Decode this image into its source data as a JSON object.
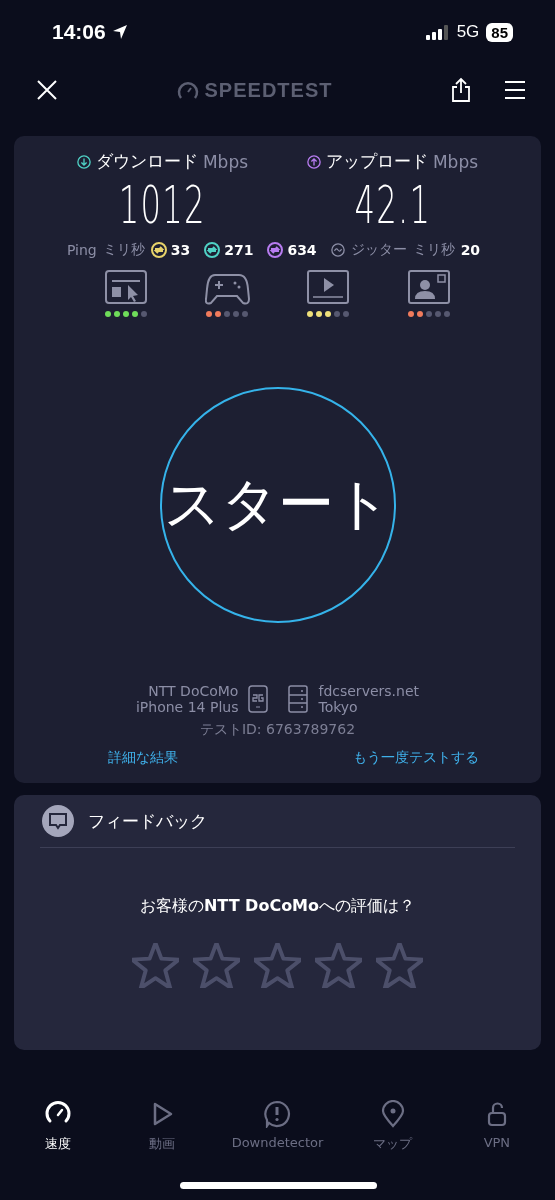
{
  "status_bar": {
    "time": "14:06",
    "network": "5G",
    "battery": "85"
  },
  "header": {
    "logo": "SPEEDTEST"
  },
  "results": {
    "download": {
      "label": "ダウンロード",
      "unit": "Mbps",
      "value": "1012"
    },
    "upload": {
      "label": "アップロード",
      "unit": "Mbps",
      "value": "42.1"
    },
    "ping": {
      "label": "Ping",
      "unit": "ミリ秒",
      "values": [
        {
          "value": "33",
          "color": "#e8d36a"
        },
        {
          "value": "271",
          "color": "#4fd1c5"
        },
        {
          "value": "634",
          "color": "#b77cf0"
        }
      ]
    },
    "jitter": {
      "label": "ジッター",
      "unit": "ミリ秒",
      "value": "20"
    }
  },
  "quality": [
    {
      "kind": "browsing",
      "level": 0.8,
      "color": "#6fdc5a"
    },
    {
      "kind": "gaming",
      "level": 0.4,
      "color": "#f07b5c"
    },
    {
      "kind": "video",
      "level": 0.6,
      "color": "#efe07a"
    },
    {
      "kind": "video_call",
      "level": 0.4,
      "color": "#f07b5c"
    }
  ],
  "start_button": {
    "label": "スタート"
  },
  "connection": {
    "provider": "NTT DoCoMo",
    "device": "iPhone 14 Plus",
    "server": "fdcservers.net",
    "location": "Tokyo"
  },
  "test_id": "テストID: 6763789762",
  "links": [
    "詳細な結果",
    "もう一度テストする"
  ],
  "feedback": {
    "title": "フィードバック",
    "question": "お客様の**NTT DoCoMo**への評価は？",
    "stars": 0
  },
  "tabs": [
    {
      "label": "速度",
      "kind": "speed",
      "selected": true
    },
    {
      "label": "動画",
      "kind": "video",
      "selected": false
    },
    {
      "label": "Downdetector",
      "kind": "alert",
      "selected": false
    },
    {
      "label": "マップ",
      "kind": "map",
      "selected": false
    },
    {
      "label": "VPN",
      "kind": "vpn",
      "selected": false
    }
  ]
}
